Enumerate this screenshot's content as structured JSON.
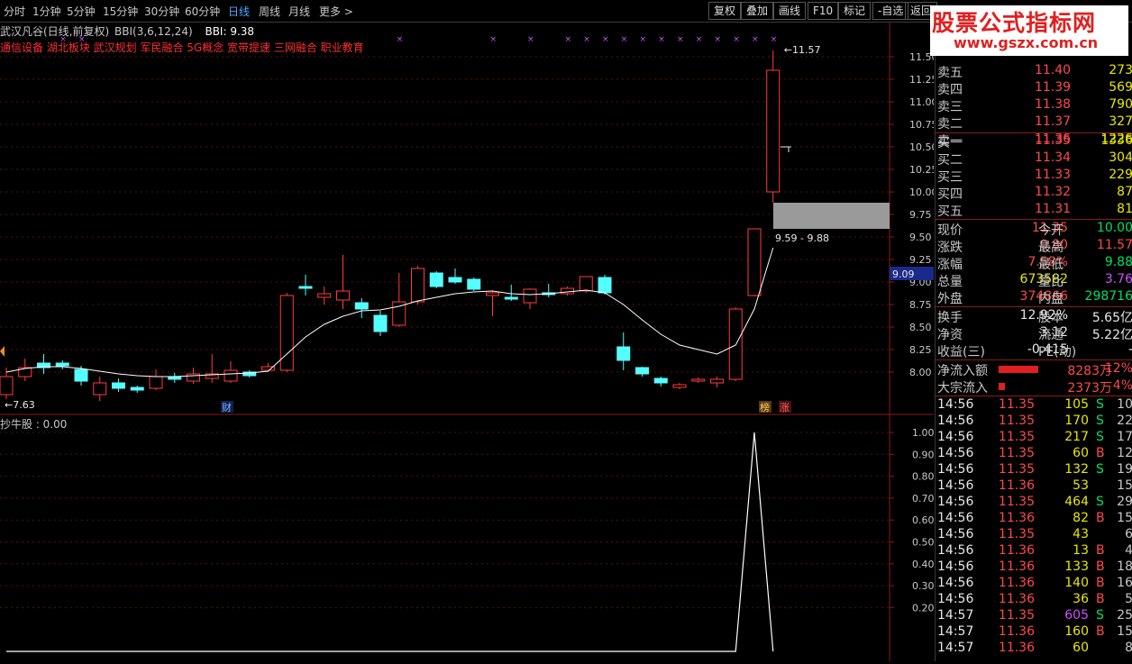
{
  "toolbar": {
    "periods": [
      "分时",
      "1分钟",
      "5分钟",
      "15分钟",
      "30分钟",
      "60分钟",
      "日线",
      "周线",
      "月线",
      "更多 >"
    ],
    "active_period": "日线",
    "buttons": [
      "复权",
      "叠加",
      "画线",
      "F10",
      "标记",
      "-自选",
      "返回"
    ]
  },
  "logo": {
    "line1": "股票公式指标网",
    "line2": "www.gszx.com.cn"
  },
  "main_chart": {
    "title": "武汉凡谷(日线,前复权)",
    "indicator_label": "BBI(3,6,12,24)",
    "indicator_value": "BBI: 9.38",
    "concepts": "通信设备 湖北板块 武汉规划 军民融合 5G概念 宽带提速 三网融合 职业教育",
    "high_label": "11.57",
    "low_label": "7.63",
    "range_label": "9.59 - 9.88",
    "price_tag": "9.09",
    "markers": {
      "cai": "财",
      "bang": "榜",
      "zhang": "涨"
    },
    "y_ticks": [
      "11.50",
      "11.25",
      "11.00",
      "10.75",
      "10.50",
      "10.25",
      "10.00",
      "9.75",
      "9.50",
      "9.25",
      "9.00",
      "8.75",
      "8.50",
      "8.25",
      "8.00"
    ]
  },
  "sub_chart": {
    "title": "抄牛股 : 0.00",
    "y_ticks": [
      "1.00",
      "0.90",
      "0.80",
      "0.70",
      "0.60",
      "0.50",
      "0.40",
      "0.30",
      "0.20"
    ]
  },
  "chart_data": {
    "type": "candlestick",
    "candles": [
      {
        "o": 7.75,
        "c": 7.95,
        "h": 8.05,
        "l": 7.7
      },
      {
        "o": 7.95,
        "c": 8.05,
        "h": 8.15,
        "l": 7.9
      },
      {
        "o": 8.1,
        "c": 8.05,
        "h": 8.2,
        "l": 7.98
      },
      {
        "o": 8.1,
        "c": 8.07,
        "h": 8.13,
        "l": 8.03
      },
      {
        "o": 8.03,
        "c": 7.9,
        "h": 8.07,
        "l": 7.85
      },
      {
        "o": 7.75,
        "c": 7.88,
        "h": 7.95,
        "l": 7.68
      },
      {
        "o": 7.88,
        "c": 7.82,
        "h": 7.93,
        "l": 7.78
      },
      {
        "o": 7.83,
        "c": 7.8,
        "h": 7.85,
        "l": 7.77
      },
      {
        "o": 7.82,
        "c": 7.95,
        "h": 8.03,
        "l": 7.8
      },
      {
        "o": 7.95,
        "c": 7.92,
        "h": 7.99,
        "l": 7.88
      },
      {
        "o": 7.9,
        "c": 7.98,
        "h": 8.05,
        "l": 7.87
      },
      {
        "o": 7.93,
        "c": 7.98,
        "h": 8.2,
        "l": 7.88
      },
      {
        "o": 7.9,
        "c": 8.02,
        "h": 8.12,
        "l": 7.88
      },
      {
        "o": 8.0,
        "c": 7.96,
        "h": 8.02,
        "l": 7.94
      },
      {
        "o": 8.02,
        "c": 8.06,
        "h": 8.1,
        "l": 8.0
      },
      {
        "o": 8.02,
        "c": 8.85,
        "h": 8.88,
        "l": 8.0
      },
      {
        "o": 8.95,
        "c": 8.93,
        "h": 9.08,
        "l": 8.85
      },
      {
        "o": 8.83,
        "c": 8.87,
        "h": 8.95,
        "l": 8.75
      },
      {
        "o": 8.8,
        "c": 8.9,
        "h": 9.3,
        "l": 8.7
      },
      {
        "o": 8.77,
        "c": 8.7,
        "h": 8.82,
        "l": 8.6
      },
      {
        "o": 8.63,
        "c": 8.45,
        "h": 8.68,
        "l": 8.4
      },
      {
        "o": 8.52,
        "c": 8.78,
        "h": 9.1,
        "l": 8.5
      },
      {
        "o": 8.78,
        "c": 9.15,
        "h": 9.18,
        "l": 8.75
      },
      {
        "o": 9.1,
        "c": 8.95,
        "h": 9.12,
        "l": 8.93
      },
      {
        "o": 9.05,
        "c": 9.0,
        "h": 9.15,
        "l": 8.98
      },
      {
        "o": 9.03,
        "c": 8.92,
        "h": 9.05,
        "l": 8.9
      },
      {
        "o": 8.85,
        "c": 8.88,
        "h": 8.9,
        "l": 8.62
      },
      {
        "o": 8.83,
        "c": 8.81,
        "h": 8.97,
        "l": 8.79
      },
      {
        "o": 8.77,
        "c": 8.92,
        "h": 8.93,
        "l": 8.7
      },
      {
        "o": 8.88,
        "c": 8.86,
        "h": 8.98,
        "l": 8.83
      },
      {
        "o": 8.87,
        "c": 8.93,
        "h": 8.95,
        "l": 8.85
      },
      {
        "o": 8.9,
        "c": 9.06,
        "h": 9.06,
        "l": 8.88
      },
      {
        "o": 9.05,
        "c": 8.88,
        "h": 9.08,
        "l": 8.86
      },
      {
        "o": 8.28,
        "c": 8.13,
        "h": 8.44,
        "l": 8.02
      },
      {
        "o": 8.05,
        "c": 7.98,
        "h": 8.06,
        "l": 7.95
      },
      {
        "o": 7.93,
        "c": 7.88,
        "h": 7.95,
        "l": 7.84
      },
      {
        "o": 7.83,
        "c": 7.86,
        "h": 7.88,
        "l": 7.81
      },
      {
        "o": 7.9,
        "c": 7.92,
        "h": 7.94,
        "l": 7.88
      },
      {
        "o": 7.88,
        "c": 7.92,
        "h": 7.95,
        "l": 7.83
      },
      {
        "o": 7.92,
        "c": 8.7,
        "h": 8.72,
        "l": 7.9
      },
      {
        "o": 8.85,
        "c": 9.59,
        "h": 9.59,
        "l": 8.84
      },
      {
        "o": 10.0,
        "c": 11.35,
        "h": 11.57,
        "l": 9.88
      }
    ],
    "bbi": [
      8.0,
      8.04,
      8.06,
      8.06,
      8.04,
      8.01,
      7.98,
      7.96,
      7.95,
      7.95,
      7.96,
      7.97,
      7.98,
      7.99,
      8.01,
      8.2,
      8.39,
      8.53,
      8.62,
      8.68,
      8.69,
      8.73,
      8.79,
      8.83,
      8.87,
      8.89,
      8.9,
      8.87,
      8.86,
      8.87,
      8.89,
      8.91,
      8.88,
      8.75,
      8.58,
      8.42,
      8.3,
      8.25,
      8.2,
      8.3,
      8.7,
      9.38
    ],
    "sub_values": [
      0,
      0,
      0,
      0,
      0,
      0,
      0,
      0,
      0,
      0,
      0,
      0,
      0,
      0,
      0,
      0,
      0,
      0,
      0,
      0,
      0,
      0,
      0,
      0,
      0,
      0,
      0,
      0,
      0,
      0,
      0,
      0,
      0,
      0,
      0,
      0,
      0,
      0,
      0,
      0,
      1,
      0,
      0
    ],
    "ylim": [
      7.6,
      11.65
    ]
  },
  "quote": {
    "asks": [
      {
        "label": "卖五",
        "price": "11.40",
        "vol": "273"
      },
      {
        "label": "卖四",
        "price": "11.39",
        "vol": "569"
      },
      {
        "label": "卖三",
        "price": "11.38",
        "vol": "790"
      },
      {
        "label": "卖二",
        "price": "11.37",
        "vol": "327"
      },
      {
        "label": "卖一",
        "price": "11.36",
        "vol": "1226"
      }
    ],
    "bids": [
      {
        "label": "买一",
        "price": "11.35",
        "vol": "1336"
      },
      {
        "label": "买二",
        "price": "11.34",
        "vol": "304"
      },
      {
        "label": "买三",
        "price": "11.33",
        "vol": "229"
      },
      {
        "label": "买四",
        "price": "11.32",
        "vol": "87"
      },
      {
        "label": "买五",
        "price": "11.31",
        "vol": "81"
      }
    ],
    "stats": [
      {
        "l1": "现价",
        "v1": "11.35",
        "c1": "red",
        "l2": "今开",
        "v2": "10.00",
        "c2": "green"
      },
      {
        "l1": "涨跌",
        "v1": "0.80",
        "c1": "red",
        "l2": "最高",
        "v2": "11.57",
        "c2": "red"
      },
      {
        "l1": "涨幅",
        "v1": "7.58%",
        "c1": "red",
        "l2": "最低",
        "v2": "9.88",
        "c2": "green"
      },
      {
        "l1": "总量",
        "v1": "673582",
        "c1": "yellow",
        "l2": "量比",
        "v2": "3.76",
        "c2": "purple"
      },
      {
        "l1": "外盘",
        "v1": "374866",
        "c1": "red",
        "l2": "内盘",
        "v2": "298716",
        "c2": "green"
      }
    ],
    "stats2": [
      {
        "l1": "换手",
        "v1": "12.92%",
        "l2": "股本",
        "v2": "5.65亿"
      },
      {
        "l1": "净资",
        "v1": "3.12",
        "l2": "流通",
        "v2": "5.22亿"
      },
      {
        "l1": "收益(三)",
        "v1": "-0.415",
        "l2": "PE(动)",
        "v2": "-"
      }
    ],
    "flows": [
      {
        "label": "净流入额",
        "value": "8283万",
        "pct": "12%",
        "bar": 0.42
      },
      {
        "label": "大宗流入",
        "value": "2373万",
        "pct": "4%",
        "bar": 0.07
      }
    ],
    "ticks": [
      {
        "t": "14:56",
        "p": "11.35",
        "v": "105",
        "s": "S",
        "n": "10"
      },
      {
        "t": "14:56",
        "p": "11.35",
        "v": "170",
        "s": "S",
        "n": "22"
      },
      {
        "t": "14:56",
        "p": "11.35",
        "v": "217",
        "s": "S",
        "n": "17"
      },
      {
        "t": "14:56",
        "p": "11.35",
        "v": "60",
        "s": "B",
        "n": "12"
      },
      {
        "t": "14:56",
        "p": "11.35",
        "v": "132",
        "s": "S",
        "n": "19"
      },
      {
        "t": "14:56",
        "p": "11.36",
        "v": "53",
        "s": "",
        "n": "15"
      },
      {
        "t": "14:56",
        "p": "11.35",
        "v": "464",
        "s": "S",
        "n": "29"
      },
      {
        "t": "14:56",
        "p": "11.36",
        "v": "82",
        "s": "B",
        "n": "15"
      },
      {
        "t": "14:56",
        "p": "11.35",
        "v": "43",
        "s": "",
        "n": "6"
      },
      {
        "t": "14:56",
        "p": "11.36",
        "v": "13",
        "s": "B",
        "n": "4"
      },
      {
        "t": "14:56",
        "p": "11.36",
        "v": "133",
        "s": "B",
        "n": "18"
      },
      {
        "t": "14:56",
        "p": "11.36",
        "v": "140",
        "s": "B",
        "n": "16"
      },
      {
        "t": "14:56",
        "p": "11.36",
        "v": "36",
        "s": "B",
        "n": "5"
      },
      {
        "t": "14:57",
        "p": "11.35",
        "v": "605",
        "s": "S",
        "n": "25"
      },
      {
        "t": "14:57",
        "p": "11.36",
        "v": "160",
        "s": "B",
        "n": "15"
      },
      {
        "t": "14:57",
        "p": "11.36",
        "v": "60",
        "s": "",
        "n": "8"
      }
    ]
  }
}
